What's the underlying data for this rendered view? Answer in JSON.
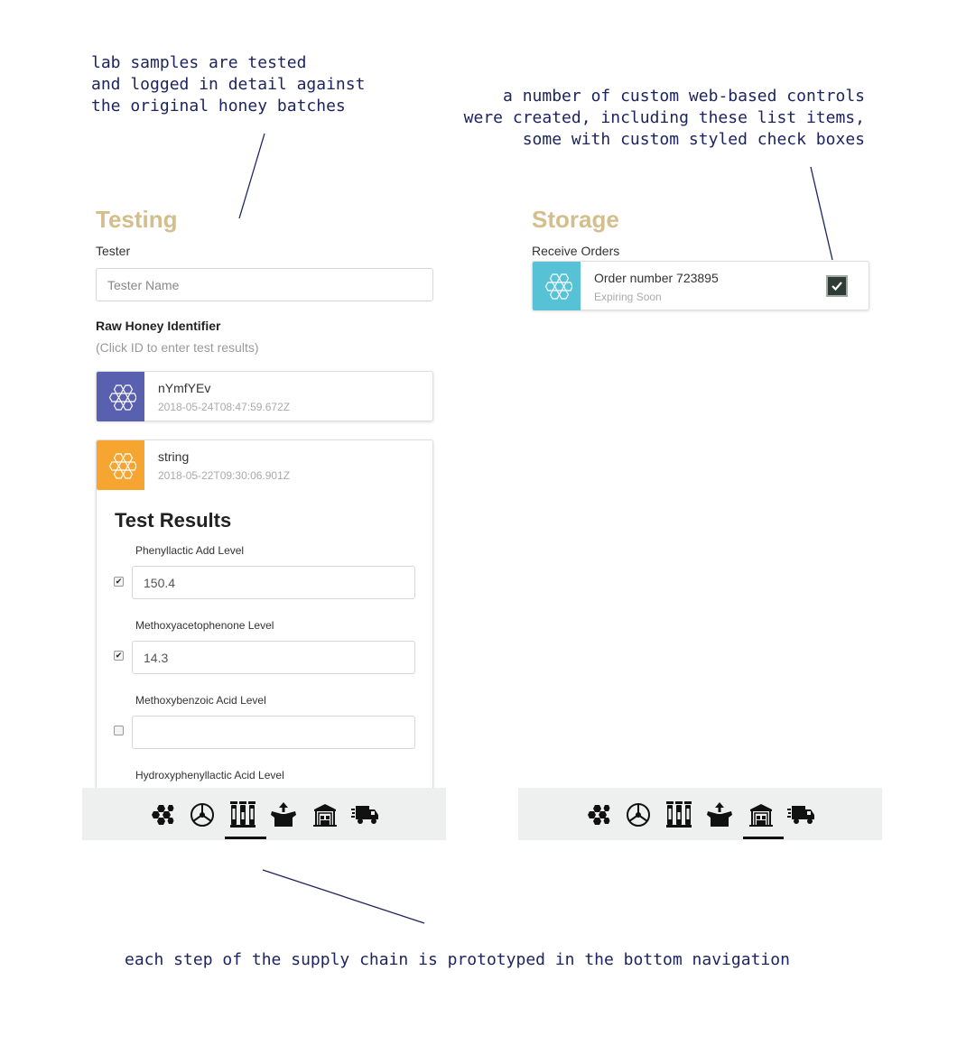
{
  "annotations": {
    "left": "lab samples are tested\nand logged in detail against\nthe original honey batches",
    "right": "a number of custom web-based controls\nwere created, including these list items,\nsome with custom styled check boxes",
    "bottom": "each step of the supply chain is prototyped in the bottom navigation"
  },
  "testing": {
    "title": "Testing",
    "tester_label": "Tester",
    "tester_placeholder": "Tester Name",
    "tester_value": "",
    "identifier_label": "Raw Honey Identifier",
    "identifier_hint": "(Click ID to enter test results)",
    "batches": [
      {
        "id": "nYmfYEv",
        "timestamp": "2018-05-24T08:47:59.672Z",
        "color": "#5a60b0"
      },
      {
        "id": "string",
        "timestamp": "2018-05-22T09:30:06.901Z",
        "color": "#f5a530"
      }
    ],
    "results": {
      "title": "Test Results",
      "fields": [
        {
          "label": "Phenyllactic Add Level",
          "value": "150.4",
          "checked": true
        },
        {
          "label": "Methoxyacetophenone Level",
          "value": "14.3",
          "checked": true
        },
        {
          "label": "Methoxybenzoic Acid Level",
          "value": "",
          "checked": false
        },
        {
          "label": "Hydroxyphenyllactic Acid Level",
          "value": "",
          "checked": false
        }
      ]
    }
  },
  "storage": {
    "title": "Storage",
    "receive_label": "Receive Orders",
    "order": {
      "title": "Order number 723895",
      "status": "Expiring Soon",
      "color": "#57c2d6",
      "checked": true
    }
  },
  "nav": {
    "items": [
      "hive-icon",
      "extractor-icon",
      "test-tubes-icon",
      "package-icon",
      "warehouse-icon",
      "truck-icon"
    ],
    "active_left": "test-tubes-icon",
    "active_right": "warehouse-icon"
  },
  "colors": {
    "heading": "#d4be8c",
    "annotation": "#1d2460",
    "nav_bg": "#eef0f0"
  }
}
